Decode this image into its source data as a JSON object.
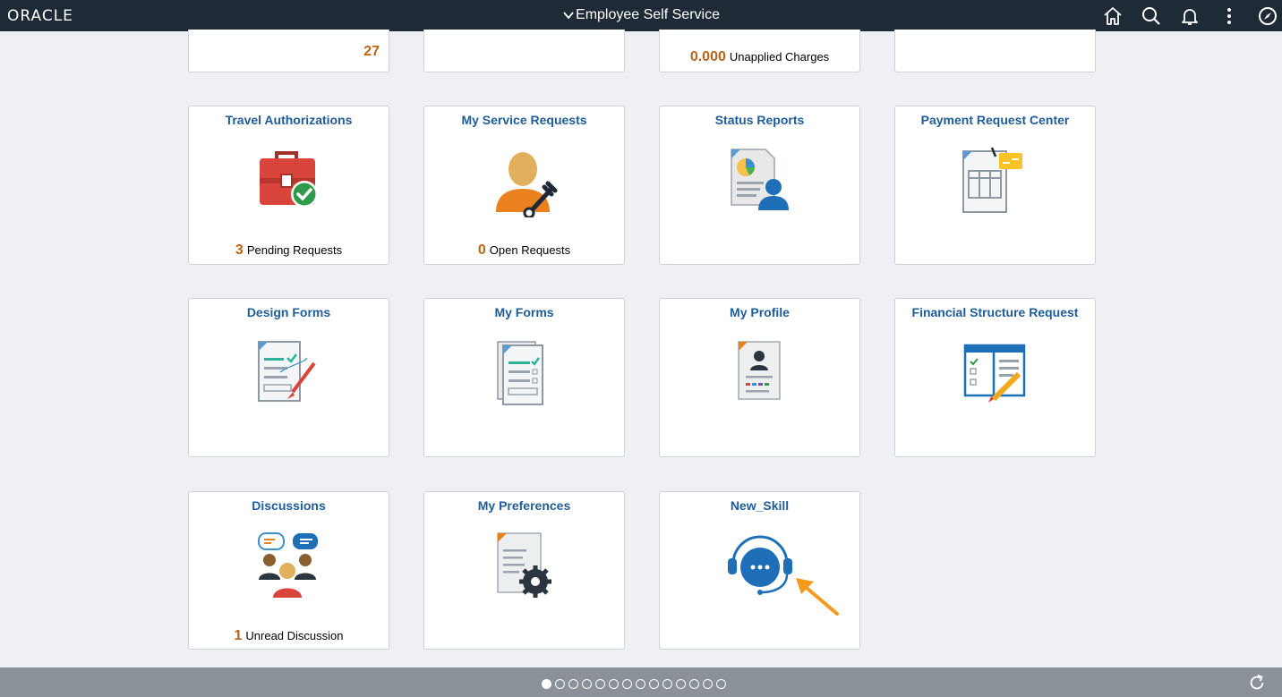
{
  "header": {
    "logo": "ORACLE",
    "title": "Employee Self Service",
    "icons": [
      "home-icon",
      "search-icon",
      "bell-icon",
      "more-icon",
      "navigator-icon"
    ]
  },
  "partial_tiles": [
    {
      "count": "27",
      "label": ""
    },
    {
      "count": "",
      "label": ""
    },
    {
      "count": "0.000",
      "label": "Unapplied Charges"
    },
    {
      "count": "",
      "label": ""
    }
  ],
  "tiles": [
    {
      "title": "Travel Authorizations",
      "icon": "briefcase-check-icon",
      "count": "3",
      "count_label": "Pending Requests"
    },
    {
      "title": "My Service Requests",
      "icon": "person-wrench-icon",
      "count": "0",
      "count_label": "Open Requests"
    },
    {
      "title": "Status Reports",
      "icon": "report-person-icon",
      "count": "",
      "count_label": ""
    },
    {
      "title": "Payment Request Center",
      "icon": "payment-document-icon",
      "count": "",
      "count_label": ""
    },
    {
      "title": "Design Forms",
      "icon": "form-brush-icon",
      "count": "",
      "count_label": ""
    },
    {
      "title": "My Forms",
      "icon": "forms-stack-icon",
      "count": "",
      "count_label": ""
    },
    {
      "title": "My Profile",
      "icon": "profile-document-icon",
      "count": "",
      "count_label": ""
    },
    {
      "title": "Financial Structure Request",
      "icon": "structure-pencil-icon",
      "count": "",
      "count_label": ""
    },
    {
      "title": "Discussions",
      "icon": "discussion-people-icon",
      "count": "1",
      "count_label": "Unread Discussion"
    },
    {
      "title": "My Preferences",
      "icon": "document-gear-icon",
      "count": "",
      "count_label": ""
    },
    {
      "title": "New_Skill",
      "icon": "headset-chat-icon",
      "count": "",
      "count_label": ""
    }
  ],
  "pager": {
    "total_pages": 14,
    "current_page": 1
  },
  "footer": {
    "icon": "refresh-icon"
  },
  "colors": {
    "header_bg": "#1f2a37",
    "title_blue": "#1f5c99",
    "count_orange": "#b7651c",
    "footer_bg": "#8b9199"
  }
}
